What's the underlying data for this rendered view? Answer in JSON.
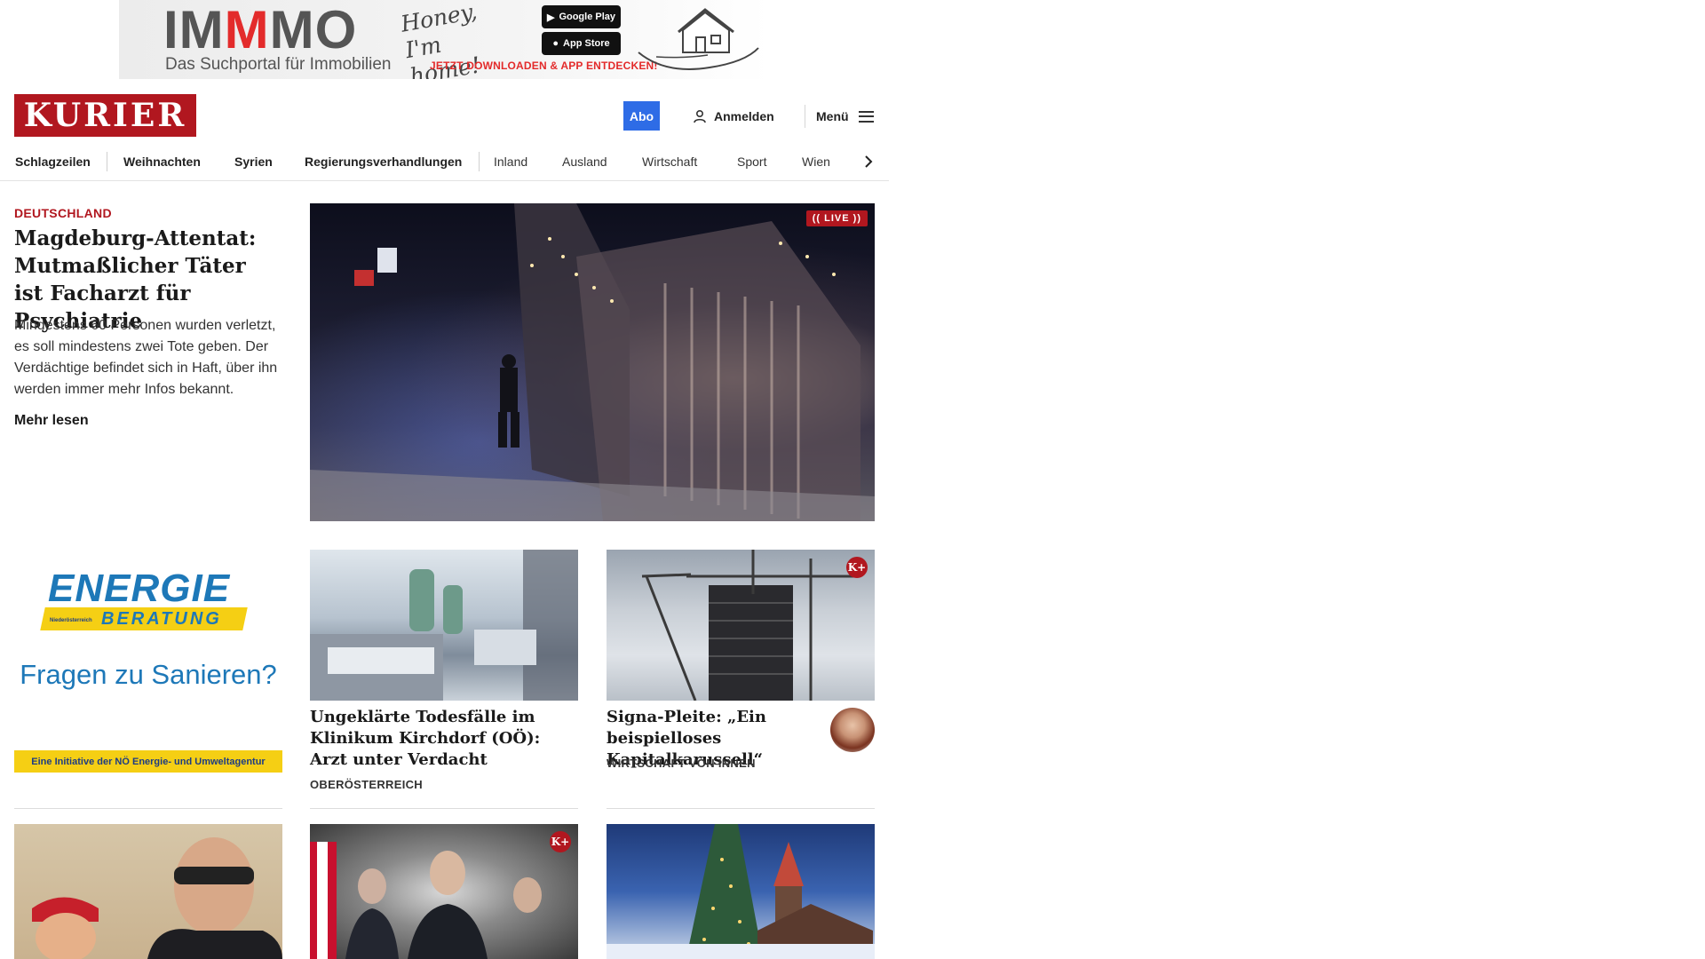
{
  "ad_top": {
    "brand_left": "IM",
    "brand_mid": "M",
    "brand_right": "MO",
    "tagline": "Das Suchportal für Immobilien",
    "handwritten": "Honey, I'm home!",
    "google_play": "Google Play",
    "app_store": "App Store",
    "cta": "JETZT DOWNLOADEN & APP ENTDECKEN!"
  },
  "header": {
    "logo": "KURIER",
    "abo": "Abo",
    "login": "Anmelden",
    "menu": "Menü"
  },
  "nav": {
    "items": [
      "Schlagzeilen",
      "Weihnachten",
      "Syrien",
      "Regierungsverhandlungen",
      "Inland",
      "Ausland",
      "Wirtschaft",
      "Sport",
      "Wien"
    ]
  },
  "lead": {
    "category": "DEUTSCHLAND",
    "title": "Magdeburg-Attentat: Mutmaßlicher Täter ist Facharzt für Psychiatrie",
    "teaser": "Mindestens 60 Personen wurden verletzt, es soll mindestens zwei Tote geben. Der Verdächtige befindet sich in Haft, über ihn werden immer mehr Infos bekannt.",
    "more": "Mehr lesen",
    "badge": "LIVE"
  },
  "ad_side": {
    "brand_line1": "ENERGIE",
    "brand_line2": "BERATUNG",
    "brand_sub": "Niederösterreich",
    "headline": "Fragen zu Sanieren?",
    "initiative": "Eine Initiative der NÖ Energie- und Umweltagentur"
  },
  "cards": [
    {
      "title": "Ungeklärte Todesfälle im Klini­kum Kirchdorf (OÖ): Arzt unter Verdacht",
      "category": "OBERÖSTERREICH"
    },
    {
      "title": "Signa-Pleite: „Ein beispiel­loses Kapitalkarussell“",
      "category": "WIRTSCHAFT VON INNEN",
      "badge": "K+"
    }
  ],
  "bottom_cards": [
    {
      "badge": "K+"
    }
  ],
  "colors": {
    "brand_red": "#b1171f",
    "abo_blue": "#2e6ce6",
    "energie_yellow": "#f5cf14",
    "energie_blue": "#1d78b8"
  }
}
